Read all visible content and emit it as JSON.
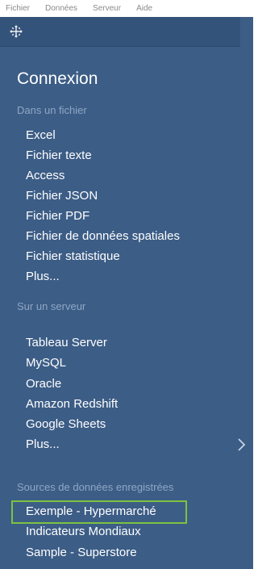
{
  "menubar": {
    "items": [
      "Fichier",
      "Données",
      "Serveur",
      "Aide"
    ]
  },
  "logo": {
    "icon": "tableau-logo-icon"
  },
  "connection": {
    "title": "Connexion",
    "file_section": {
      "label": "Dans un fichier",
      "items": [
        "Excel",
        "Fichier texte",
        "Access",
        "Fichier JSON",
        "Fichier PDF",
        "Fichier de données spatiales",
        "Fichier statistique",
        "Plus..."
      ]
    },
    "server_section": {
      "label": "Sur un serveur",
      "items": [
        "Tableau Server",
        "MySQL",
        "Oracle",
        "Amazon Redshift",
        "Google Sheets",
        "Plus..."
      ]
    },
    "saved_section": {
      "label": "Sources de données enregistrées",
      "items": [
        "Exemple - Hypermarché",
        "Indicateurs Mondiaux",
        "Sample - Superstore"
      ],
      "highlighted": "Exemple - Hypermarché"
    }
  },
  "colors": {
    "panel_bg": "#3c5d86",
    "logo_strip_bg": "#34537a",
    "section_label": "#8fa6c4",
    "highlight_border": "#7dc242"
  },
  "expand_icon": "chevron-right-icon"
}
